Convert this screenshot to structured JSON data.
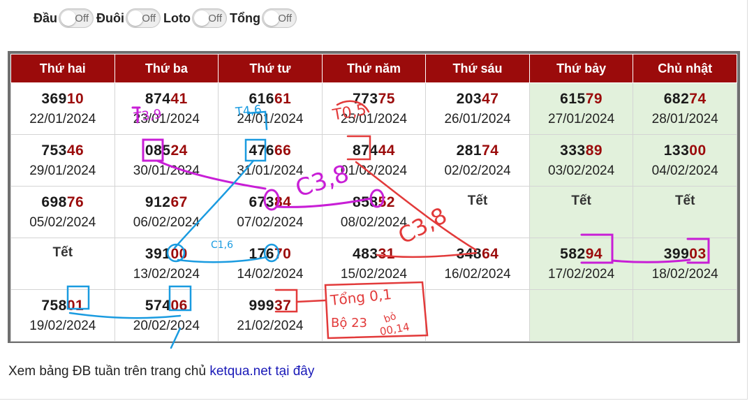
{
  "filters": [
    {
      "label": "Đầu",
      "state": "Off"
    },
    {
      "label": "Đuôi",
      "state": "Off"
    },
    {
      "label": "Loto",
      "state": "Off"
    },
    {
      "label": "Tổng",
      "state": "Off"
    }
  ],
  "headers": [
    "Thứ hai",
    "Thứ ba",
    "Thứ tư",
    "Thứ năm",
    "Thứ sáu",
    "Thứ bảy",
    "Chủ nhật"
  ],
  "rows": [
    [
      {
        "head": "369",
        "tail": "10",
        "date": "22/01/2024"
      },
      {
        "head": "874",
        "tail": "41",
        "date": "23/01/2024"
      },
      {
        "head": "616",
        "tail": "61",
        "date": "24/01/2024"
      },
      {
        "head": "773",
        "tail": "75",
        "date": "25/01/2024"
      },
      {
        "head": "203",
        "tail": "47",
        "date": "26/01/2024"
      },
      {
        "head": "615",
        "tail": "79",
        "date": "27/01/2024"
      },
      {
        "head": "682",
        "tail": "74",
        "date": "28/01/2024"
      }
    ],
    [
      {
        "head": "753",
        "tail": "46",
        "date": "29/01/2024"
      },
      {
        "head": "085",
        "tail": "24",
        "date": "30/01/2024"
      },
      {
        "head": "476",
        "tail": "66",
        "date": "31/01/2024"
      },
      {
        "head": "874",
        "tail": "44",
        "date": "01/02/2024"
      },
      {
        "head": "281",
        "tail": "74",
        "date": "02/02/2024"
      },
      {
        "head": "333",
        "tail": "89",
        "date": "03/02/2024"
      },
      {
        "head": "133",
        "tail": "00",
        "date": "04/02/2024"
      }
    ],
    [
      {
        "head": "698",
        "tail": "76",
        "date": "05/02/2024"
      },
      {
        "head": "912",
        "tail": "67",
        "date": "06/02/2024"
      },
      {
        "head": "673",
        "tail": "84",
        "date": "07/02/2024"
      },
      {
        "head": "858",
        "tail": "52",
        "date": "08/02/2024"
      },
      {
        "tet": "Tết"
      },
      {
        "tet": "Tết"
      },
      {
        "tet": "Tết"
      }
    ],
    [
      {
        "tet": "Tết"
      },
      {
        "head": "391",
        "tail": "00",
        "date": "13/02/2024"
      },
      {
        "head": "176",
        "tail": "70",
        "date": "14/02/2024"
      },
      {
        "head": "483",
        "tail": "31",
        "date": "15/02/2024"
      },
      {
        "head": "348",
        "tail": "64",
        "date": "16/02/2024"
      },
      {
        "head": "582",
        "tail": "94",
        "date": "17/02/2024"
      },
      {
        "head": "399",
        "tail": "03",
        "date": "18/02/2024"
      }
    ],
    [
      {
        "head": "758",
        "tail": "01",
        "date": "19/02/2024"
      },
      {
        "head": "574",
        "tail": "06",
        "date": "20/02/2024"
      },
      {
        "head": "999",
        "tail": "37",
        "date": "21/02/2024"
      },
      {},
      {},
      {},
      {}
    ]
  ],
  "footer": {
    "text": "Xem bảng ĐB tuần trên trang chủ ",
    "link": "ketqua.net tại đây"
  },
  "annotations": {
    "a1": "T3,9",
    "a2": "T4,6",
    "a3": "T0,5",
    "c38": "C3,8",
    "c38b": "C3,8",
    "c16": "C1,6",
    "note1": "Tổng 0,1",
    "note2": "Bộ 23",
    "note3": "bỏ",
    "note4": "00,14"
  },
  "colors": {
    "header_bg": "#9b0b0b",
    "tail": "#9b0b0b",
    "weekend": "#e2f1dc",
    "link": "#1a1ab8",
    "magenta": "#c81ed6",
    "blue": "#1a9be0",
    "red": "#e23a3a"
  }
}
